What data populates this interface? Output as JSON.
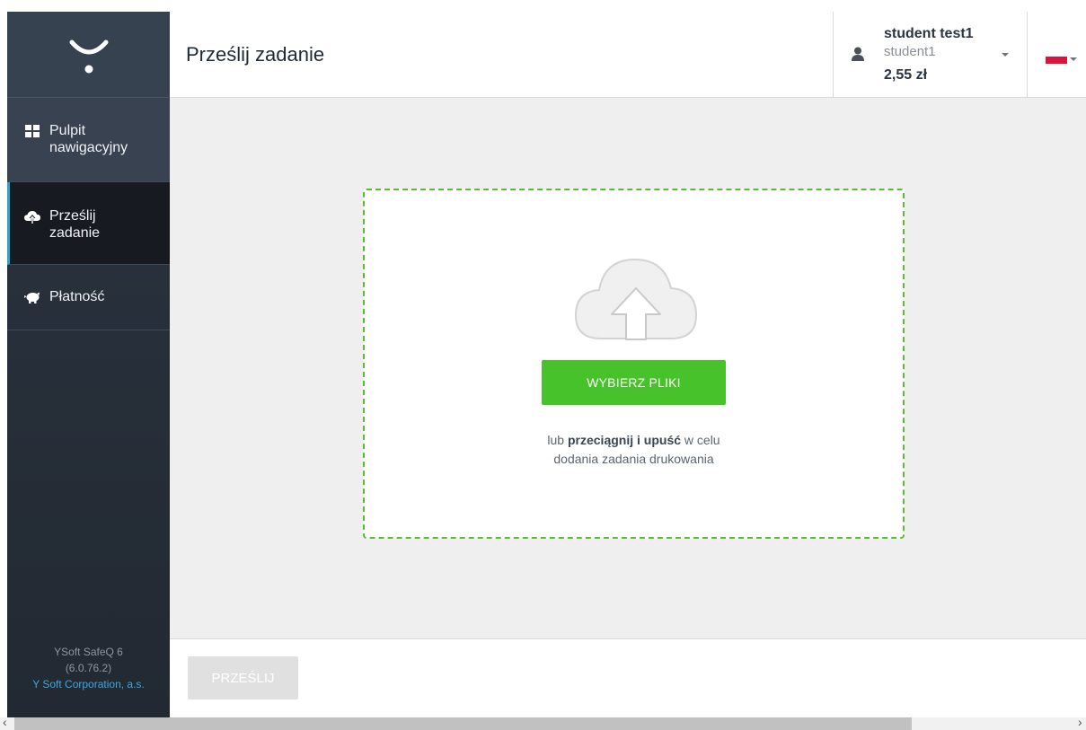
{
  "sidebar": {
    "items": [
      {
        "label": "Pulpit nawigacyjny",
        "icon": "dashboard-icon"
      },
      {
        "label": "Prześlij zadanie",
        "icon": "cloud-upload-icon",
        "active": true
      },
      {
        "label": "Płatność",
        "icon": "piggy-bank-icon"
      }
    ],
    "footer": {
      "product": "YSoft SafeQ 6",
      "version": "(6.0.76.2)",
      "company": "Y Soft Corporation, a.s."
    }
  },
  "header": {
    "title": "Prześlij zadanie",
    "user": {
      "full_name": "student test1",
      "login": "student1",
      "credit": "2,55 zł"
    },
    "language_flag": "pl"
  },
  "upload": {
    "choose_label": "WYBIERZ PLIKI",
    "hint_prefix": "lub ",
    "hint_bold": "przeciągnij i upuść",
    "hint_suffix": " w celu",
    "hint_line2": "dodania zadania drukowania"
  },
  "footer_bar": {
    "submit_label": "PRZEŚLIJ",
    "submit_disabled": true
  },
  "colors": {
    "sidebar_bg": "#2b3440",
    "accent_blue": "#2ea3c7",
    "primary_green": "#47c22a",
    "dropzone_border": "#56c02c"
  }
}
